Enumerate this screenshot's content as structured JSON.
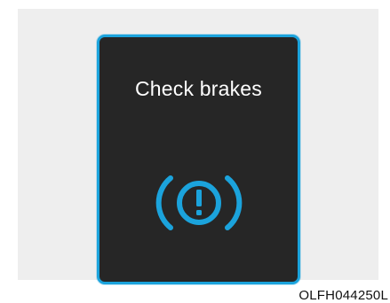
{
  "warning": {
    "message": "Check brakes",
    "icon": "brake-warning-icon",
    "accent_color": "#1ba3dc",
    "screen_color": "#262626"
  },
  "figure": {
    "code": "OLFH044250L"
  }
}
